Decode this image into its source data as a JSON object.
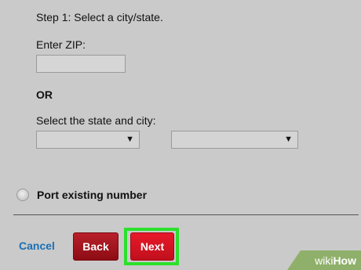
{
  "step": {
    "title": "Step 1: Select a city/state."
  },
  "zip": {
    "label": "Enter ZIP:",
    "value": ""
  },
  "or_label": "OR",
  "state_city": {
    "label": "Select the state and city:",
    "state_value": "",
    "city_value": ""
  },
  "port": {
    "label": "Port existing number",
    "selected": false
  },
  "actions": {
    "cancel_label": "Cancel",
    "back_label": "Back",
    "next_label": "Next"
  },
  "watermark": {
    "wiki": "wiki",
    "how": "How"
  },
  "colors": {
    "background": "#cacaca",
    "next_highlight": "#2ce02c",
    "cancel_link": "#1a6fb4",
    "back_button": "#9b0f18",
    "next_button": "#d8141f"
  },
  "icons": {
    "dropdown": "triangle-down-icon",
    "radio": "radio-button-icon"
  }
}
